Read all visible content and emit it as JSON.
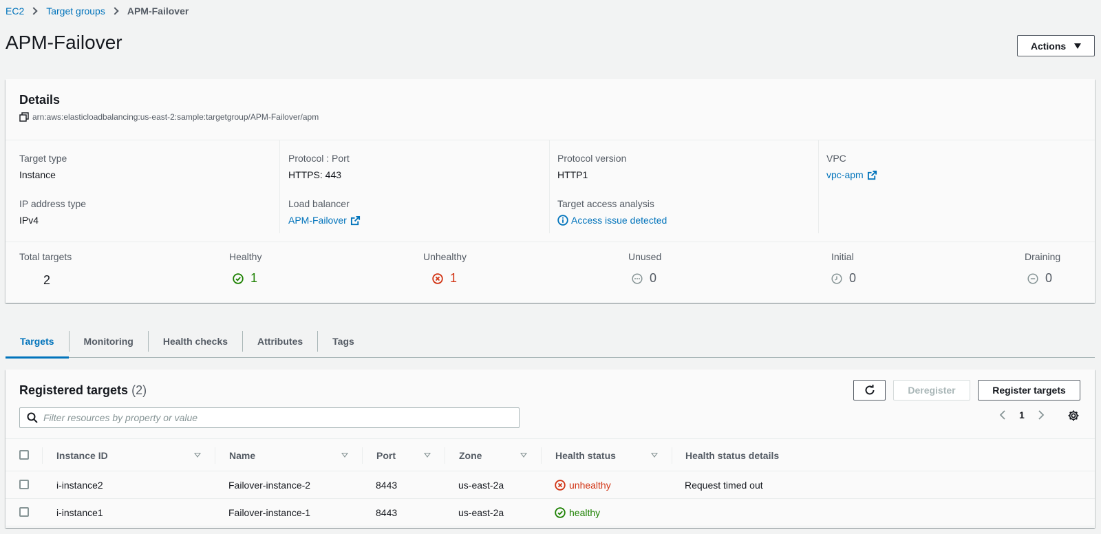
{
  "breadcrumb": {
    "items": [
      "EC2",
      "Target groups"
    ],
    "current": "APM-Failover"
  },
  "page": {
    "title": "APM-Failover",
    "actions_label": "Actions"
  },
  "details": {
    "title": "Details",
    "arn": "arn:aws:elasticloadbalancing:us-east-2:sample:targetgroup/APM-Failover/apm",
    "fields": {
      "target_type_label": "Target type",
      "target_type": "Instance",
      "ip_type_label": "IP address type",
      "ip_type": "IPv4",
      "protocol_port_label": "Protocol : Port",
      "protocol_port": "HTTPS: 443",
      "load_balancer_label": "Load balancer",
      "load_balancer": "APM-Failover",
      "protocol_version_label": "Protocol version",
      "protocol_version": "HTTP1",
      "access_analysis_label": "Target access analysis",
      "access_analysis": "Access issue detected",
      "vpc_label": "VPC",
      "vpc": "vpc-apm"
    },
    "stats": {
      "total_label": "Total targets",
      "total": "2",
      "healthy_label": "Healthy",
      "healthy": "1",
      "unhealthy_label": "Unhealthy",
      "unhealthy": "1",
      "unused_label": "Unused",
      "unused": "0",
      "initial_label": "Initial",
      "initial": "0",
      "draining_label": "Draining",
      "draining": "0"
    }
  },
  "tabs": [
    "Targets",
    "Monitoring",
    "Health checks",
    "Attributes",
    "Tags"
  ],
  "targets": {
    "title": "Registered targets",
    "count": "(2)",
    "deregister_label": "Deregister",
    "register_label": "Register targets",
    "search_placeholder": "Filter resources by property or value",
    "page_number": "1",
    "columns": [
      "Instance ID",
      "Name",
      "Port",
      "Zone",
      "Health status",
      "Health status details"
    ],
    "rows": [
      {
        "instance_id": "i-instance2",
        "name": "Failover-instance-2",
        "port": "8443",
        "zone": "us-east-2a",
        "health": "unhealthy",
        "details": "Request timed out"
      },
      {
        "instance_id": "i-instance1",
        "name": "Failover-instance-1",
        "port": "8443",
        "zone": "us-east-2a",
        "health": "healthy",
        "details": ""
      }
    ]
  },
  "colors": {
    "link": "#0073bb",
    "healthy": "#1d8102",
    "unhealthy": "#d13212"
  }
}
